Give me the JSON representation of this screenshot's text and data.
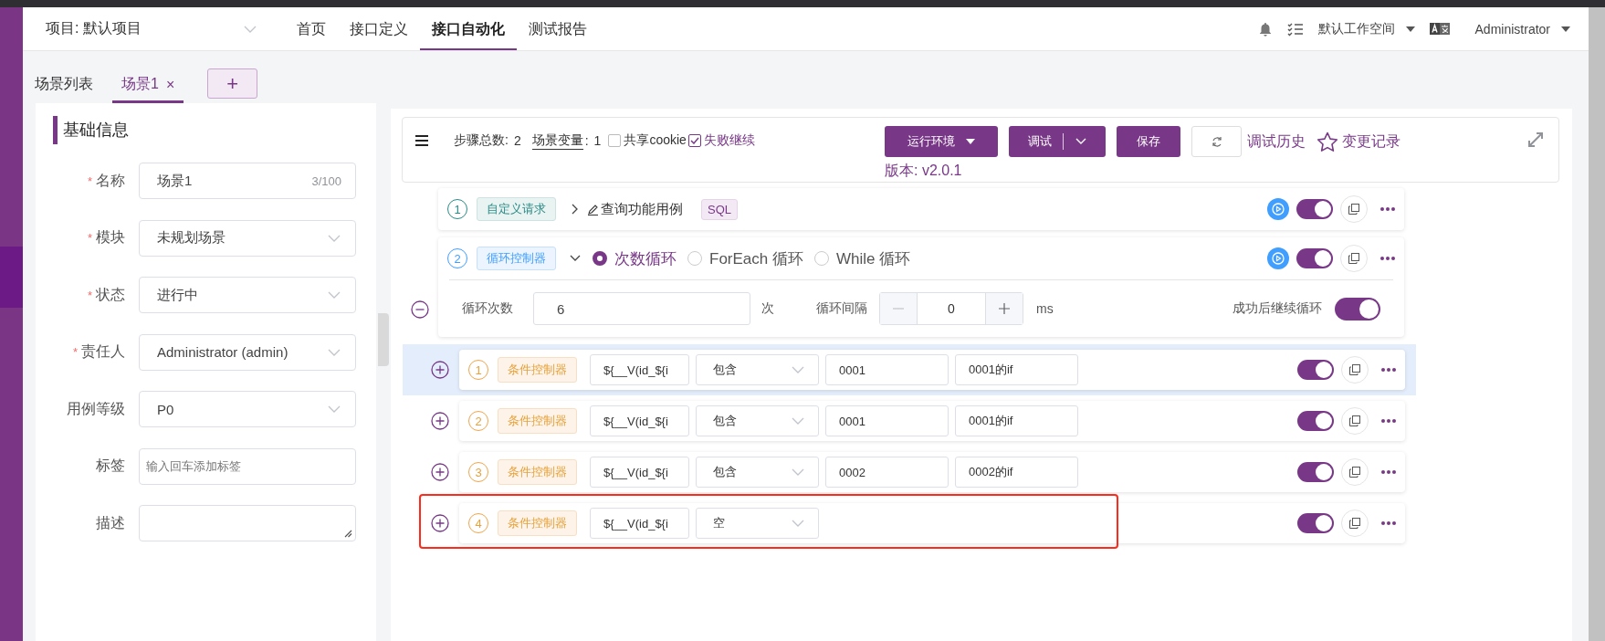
{
  "project": {
    "label": "项目: 默认项目"
  },
  "nav": [
    {
      "label": "首页",
      "selected": false
    },
    {
      "label": "接口定义",
      "selected": false
    },
    {
      "label": "接口自动化",
      "selected": true
    },
    {
      "label": "测试报告",
      "selected": false
    }
  ],
  "header_right": {
    "workspace": "默认工作空间",
    "user": "Administrator"
  },
  "tabs": [
    {
      "label": "场景列表",
      "selected": false
    },
    {
      "label": "场景1",
      "selected": true,
      "close": "×"
    }
  ],
  "add_tab": "+",
  "basic_info": {
    "title": "基础信息",
    "fields": [
      {
        "label": "名称",
        "required_mark": "*",
        "kind": "text",
        "value": "场景1",
        "counter": "3/100"
      },
      {
        "label": "模块",
        "required_mark": "*",
        "kind": "select",
        "value": "未规划场景"
      },
      {
        "label": "状态",
        "required_mark": "*",
        "kind": "select",
        "value": "进行中"
      },
      {
        "label": "责任人",
        "required_mark": "*",
        "kind": "select",
        "value": "Administrator (admin)"
      },
      {
        "label": "用例等级",
        "kind": "select",
        "value": "P0"
      },
      {
        "label": "标签",
        "kind": "tags",
        "placeholder": "输入回车添加标签"
      },
      {
        "label": "描述",
        "kind": "textarea"
      }
    ]
  },
  "toolbar": {
    "steps_label": "步骤总数:",
    "steps_count": "2",
    "vars_label": "场景变量",
    "vars_sep": ":",
    "vars_count": "1",
    "checkboxes": [
      {
        "label": "共享cookie",
        "checked": false
      },
      {
        "label": "失败继续",
        "checked": true
      }
    ],
    "env_button": "运行环境",
    "debug_button": "调试",
    "save_button": "保存",
    "history_link": "调试历史",
    "changes_link": "变更记录",
    "version": "版本: v2.0.1"
  },
  "steps": [
    {
      "kind": "request",
      "index": "1",
      "type_label": "自定义请求",
      "name": "查询功能用例",
      "tag": "SQL",
      "expanded": false,
      "enabled": true
    },
    {
      "kind": "loop",
      "index": "2",
      "type_label": "循环控制器",
      "expanded": true,
      "enabled": true,
      "loop_modes": [
        {
          "label": "次数循环",
          "selected": true
        },
        {
          "label": "ForEach 循环",
          "selected": false
        },
        {
          "label": "While 循环",
          "selected": false
        }
      ],
      "count_label": "循环次数",
      "count_value": "6",
      "count_unit": "次",
      "interval_label": "循环间隔",
      "interval_value": "0",
      "interval_unit": "ms",
      "continue_label": "成功后继续循环",
      "continue_on": true,
      "children": [
        {
          "index": "1",
          "type_label": "条件控制器",
          "variable": "${__V(id_${i",
          "operator": "包含",
          "value": "0001",
          "remark": "0001的if",
          "enabled": true,
          "hovered": true,
          "marked": false
        },
        {
          "index": "2",
          "type_label": "条件控制器",
          "variable": "${__V(id_${i",
          "operator": "包含",
          "value": "0001",
          "remark": "0001的if",
          "enabled": true,
          "hovered": false,
          "marked": false
        },
        {
          "index": "3",
          "type_label": "条件控制器",
          "variable": "${__V(id_${i",
          "operator": "包含",
          "value": "0002",
          "remark": "0002的if",
          "enabled": true,
          "hovered": false,
          "marked": false
        },
        {
          "index": "4",
          "type_label": "条件控制器",
          "variable": "${__V(id_${i",
          "operator": "空",
          "enabled": true,
          "hovered": false,
          "marked": true
        }
      ]
    }
  ]
}
